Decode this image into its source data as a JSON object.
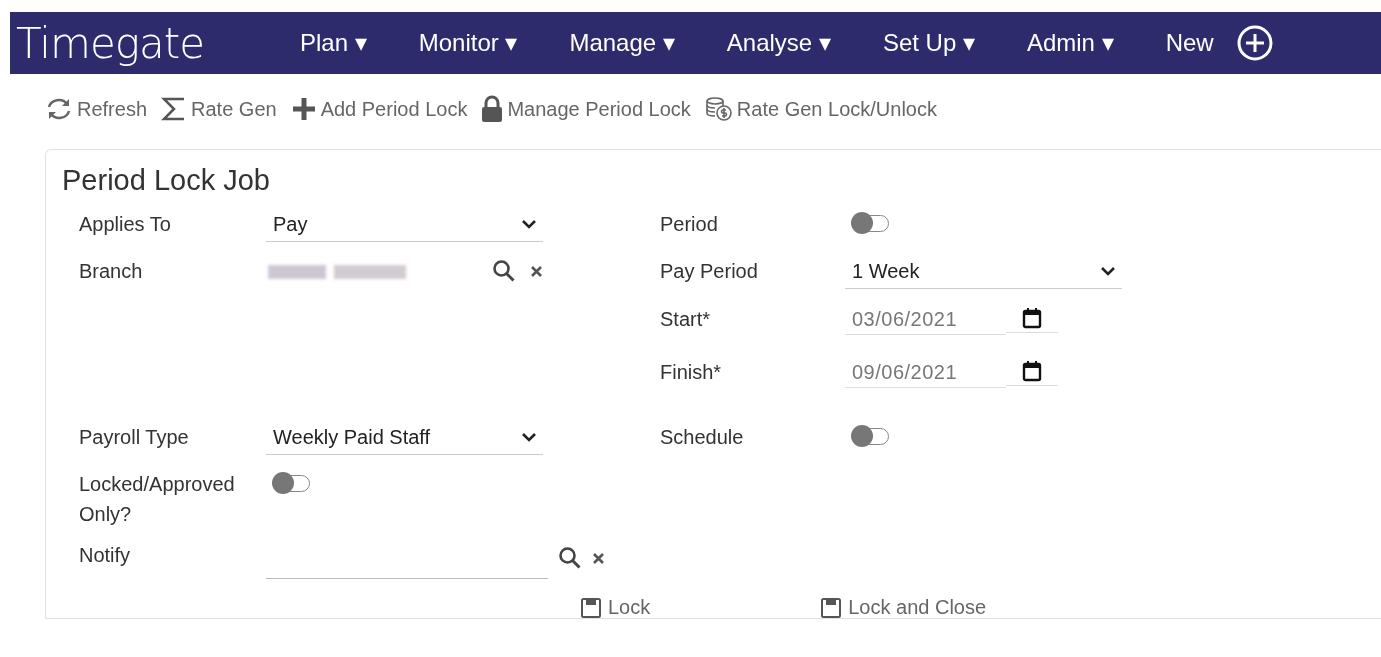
{
  "app": {
    "logo": "Timegate"
  },
  "nav": [
    {
      "kind": "menu",
      "label": "Plan",
      "caret": "▾"
    },
    {
      "kind": "menu",
      "label": "Monitor",
      "caret": "▾"
    },
    {
      "kind": "menu",
      "label": "Manage",
      "caret": "▾"
    },
    {
      "kind": "menu",
      "label": "Analyse",
      "caret": "▾"
    },
    {
      "kind": "menu",
      "label": "Set Up",
      "caret": "▾"
    },
    {
      "kind": "menu",
      "label": "Admin",
      "caret": "▾"
    },
    {
      "kind": "new",
      "label": "New"
    }
  ],
  "toolbar": [
    {
      "kind": "refresh",
      "label": "Refresh"
    },
    {
      "kind": "sigma",
      "label": "Rate Gen"
    },
    {
      "kind": "plus",
      "label": "Add Period Lock"
    },
    {
      "kind": "lock",
      "label": "Manage Period Lock"
    },
    {
      "kind": "coins",
      "label": "Rate Gen Lock/Unlock"
    }
  ],
  "form": {
    "title": "Period Lock Job",
    "left": [
      {
        "kind": "select",
        "label": "Applies To",
        "value": "Pay"
      },
      {
        "kind": "lookup",
        "label": "Branch",
        "redacted": true
      },
      {
        "kind": "select",
        "label": "Payroll Type",
        "value": "Weekly Paid Staff"
      },
      {
        "kind": "toggle",
        "label": "Locked/Approved Only?",
        "on": false
      },
      {
        "kind": "lookup",
        "label": "Notify",
        "redacted": false
      }
    ],
    "right": [
      {
        "kind": "toggle",
        "label": "Period",
        "on": false
      },
      {
        "kind": "select",
        "label": "Pay Period",
        "value": "1 Week"
      },
      {
        "kind": "date",
        "label": "Start*",
        "value": "03/06/2021"
      },
      {
        "kind": "date",
        "label": "Finish*",
        "value": "09/06/2021"
      },
      {
        "kind": "toggle",
        "label": "Schedule",
        "on": false
      }
    ],
    "buttons": [
      "Lock",
      "Lock and Close"
    ]
  }
}
